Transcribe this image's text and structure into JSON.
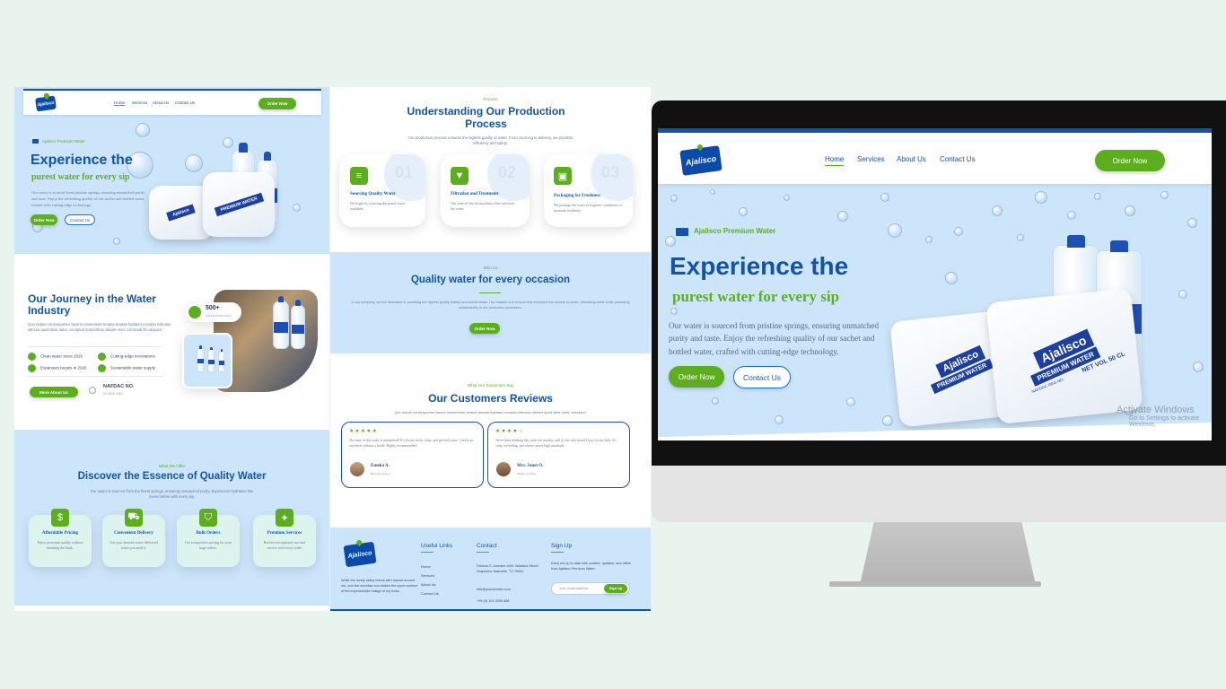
{
  "brand": {
    "logo_text": "Ajalisco"
  },
  "nav": {
    "home": "Home",
    "services": "Services",
    "about": "About Us",
    "contact": "Contact Us",
    "order": "Order Now"
  },
  "hero": {
    "badge": "Ajalisco Premium Water",
    "title": "Experience the",
    "subtitle": "purest water for every sip",
    "body": "Our water is sourced from pristine springs, ensuring unmatched purity and taste. Enjoy the refreshing quality of our sachet and bottled water, crafted with cutting-edge technology.",
    "order_btn": "Order Now",
    "contact_btn": "Contact Us"
  },
  "product": {
    "sachet_brand": "Ajalisco",
    "sachet_label": "PREMIUM WATER",
    "net_vol": "NET VOL 50 CL",
    "nafdac": "NAFDAC REG NO:"
  },
  "journey": {
    "title": "Our Journey in the Water Industry",
    "body": "Quo dolore consequuntur facere consectetur beatae beatae habitant conubia ridiculus ultrices quod alias dolor, excepturi temporibus aliquet nunc commodi illo aliquam.",
    "features": [
      "Clean water since 2025",
      "Cutting-edge innovations",
      "Expansion begins in 2026",
      "Sustainable water supply"
    ],
    "btn": "More About Us",
    "nafdac_title": "NAFDAC NO.",
    "nafdac_no": "A1-0876 NAG",
    "stat_value": "500+",
    "stat_label": "PRODUCTION DAILY"
  },
  "offer": {
    "eyebrow": "What We Offer",
    "title": "Discover the Essence of Quality Water",
    "body": "Our water is sourced from the finest springs, ensuring unmatched purity. Experience hydration like never before with every sip.",
    "cards": [
      {
        "title": "Affordable Pricing",
        "text": "Enjoy premium quality without breaking the bank."
      },
      {
        "title": "Convenient Delivery",
        "text": "Get your favorite water delivered when you need it."
      },
      {
        "title": "Bulk Orders",
        "text": "Get competitive pricing for your large orders."
      },
      {
        "title": "Premium Services",
        "text": "Receive exceptional care and service with every order."
      }
    ]
  },
  "process": {
    "eyebrow": "Process",
    "title": "Understanding Our Production Process",
    "body": "Our production process ensures the highest quality of water. From sourcing to delivery, we prioritize efficiency and safety.",
    "steps": [
      {
        "num": "01",
        "title": "Sourcing Quality Water",
        "text": "We begin by sourcing the purest water available."
      },
      {
        "num": "02",
        "title": "Filtration and Treatment",
        "text": "Our state-of-the-art machines filter and treat the water."
      },
      {
        "num": "03",
        "title": "Packaging for Freshness",
        "text": "We package the water in hygienic conditions to maintain freshness."
      }
    ]
  },
  "quality": {
    "eyebrow": "Who Us",
    "title": "Quality water for every occasion",
    "body": "In our company, we are dedicated to providing the highest quality bottled and sachet water. Our mission is to ensure that everyone has access to clean, refreshing water while promoting sustainability in our production processes.",
    "btn": "Order Now"
  },
  "reviews": {
    "eyebrow": "What Our Customers Say",
    "title": "Our Customers Reviews",
    "body": "Quo dolore consequuntur facere consectetur beatae beatae habitant conubia ridiculus ultrices quod alias dolor, excepturi.",
    "items": [
      {
        "stars": "★★★★★",
        "text": "The taste of this water is unmatched! It's always fresh, clean, and perfectly pure. I never go anywhere without a bottle. Highly recommended!",
        "name": "Emeka A.",
        "role": "Business Owner"
      },
      {
        "stars": "★★★★☆",
        "text": "We've been drinking this water for months, and it's the only brand I trust for my kids. It's crisp, refreshing, and always meets high standards.",
        "name": "Mrs. Janet O.",
        "role": "Mother of Three"
      }
    ]
  },
  "footer": {
    "about": "While the lovely valley teems with vapour around me, and the meridian sun strikes the upper surface of the impenetrable foliage of my trees.",
    "links_title": "Useful Links",
    "links": [
      "Home",
      "Services",
      "About Us",
      "Contact Us"
    ],
    "contact_title": "Contact",
    "address": "Patricia C. Amedee 4401 Waldeck Street Grapevine Nashville, TX 76051",
    "email": "info@yourdomain.com",
    "phone": "+99 (0) 101 0000 888",
    "signup_title": "Sign Up",
    "signup_body": "Keep me up to date with content, updates, and offers from Ajalisco Premium Water.",
    "email_placeholder": "Your email address",
    "signup_btn": "Sign Up"
  },
  "os": {
    "watermark_title": "Activate Windows",
    "watermark_sub": "Go to Settings to activate Windows."
  },
  "colors": {
    "primary_blue": "#1254a6",
    "accent_green": "#5cae1e",
    "light_blue_bg": "#cde5fb"
  }
}
